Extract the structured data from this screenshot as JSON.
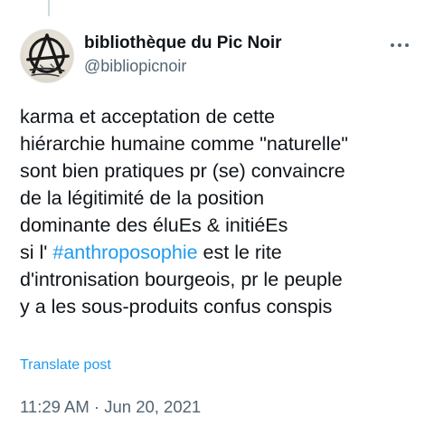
{
  "author": {
    "display_name": "bibliothèque du Pic Noir",
    "handle": "@bibliopicnoir",
    "avatar_icon": "anarchy-a-logo-icon"
  },
  "more_menu": {
    "icon": "more-horizontal-icon"
  },
  "tweet": {
    "lines": [
      {
        "text": "karma et acceptation de cette"
      },
      {
        "text": "hiérarchie humaine comme \"naturelle\""
      },
      {
        "text": "sont bien pratiques pr (se) convaincre"
      },
      {
        "text": "de la légitimité de la position"
      },
      {
        "text": "dominante des éluEs & initiéEs"
      },
      {
        "before": "si l' ",
        "hashtag": "#anthroposophie",
        "after": " est le rite"
      },
      {
        "text": "d'intronisation bourgeois, pr le peuple"
      },
      {
        "text": "y a les sous-produits confus conspis"
      }
    ],
    "translate_label": "Translate post",
    "timestamp": "11:29 AM · Jun 20, 2021"
  },
  "colors": {
    "text_primary": "#0f1419",
    "text_secondary": "#536471",
    "link": "#1d9bf0",
    "thread_line": "#cfd9de"
  }
}
